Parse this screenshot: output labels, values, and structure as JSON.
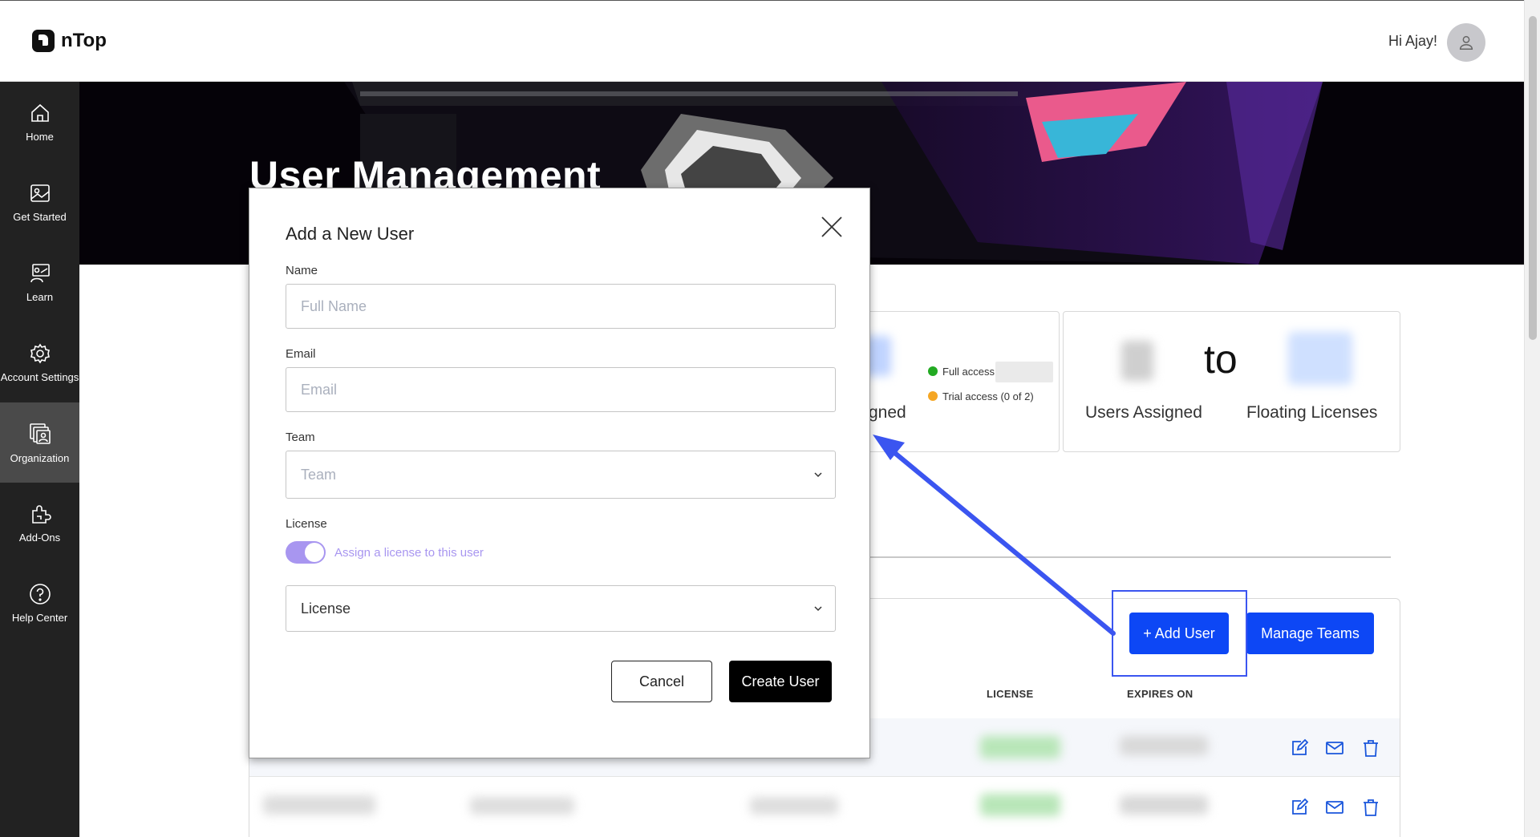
{
  "app": {
    "brand": "nTop",
    "greeting": "Hi Ajay!"
  },
  "icons": {
    "logo": "ntop-logo-icon",
    "avatar": "user-avatar-icon",
    "close": "close-icon",
    "chevron": "chevron-down-icon",
    "edit": "edit-icon",
    "email": "mail-icon",
    "delete": "trash-icon"
  },
  "sidebar": {
    "items": [
      {
        "label": "Home",
        "icon": "home-icon"
      },
      {
        "label": "Get Started",
        "icon": "image-icon"
      },
      {
        "label": "Learn",
        "icon": "learn-icon"
      },
      {
        "label": "Account Settings",
        "icon": "gear-icon"
      },
      {
        "label": "Organization",
        "icon": "organization-icon",
        "active": true
      },
      {
        "label": "Add-Ons",
        "icon": "puzzle-icon"
      },
      {
        "label": "Help Center",
        "icon": "help-icon"
      }
    ]
  },
  "hero": {
    "title": "User Management"
  },
  "license_card": {
    "partial_label": "gned",
    "legend": [
      {
        "label": "Full access",
        "color": "#22aa22"
      },
      {
        "label": "Trial access (0 of 2)",
        "color": "#f5a623"
      }
    ]
  },
  "floating_card": {
    "connector": "to",
    "left_label": "Users Assigned",
    "right_label": "Floating Licenses"
  },
  "user_table": {
    "add_user_label": "+ Add User",
    "manage_teams_label": "Manage Teams",
    "columns": [
      "LICENSE",
      "EXPIRES ON"
    ]
  },
  "modal": {
    "title": "Add a New User",
    "name": {
      "label": "Name",
      "placeholder": "Full Name",
      "value": ""
    },
    "email": {
      "label": "Email",
      "placeholder": "Email",
      "value": ""
    },
    "team": {
      "label": "Team",
      "placeholder": "Team"
    },
    "license": {
      "label": "License",
      "toggle_on": true,
      "toggle_text": "Assign a license to this user",
      "select_value": "License"
    },
    "cancel_label": "Cancel",
    "create_label": "Create User"
  },
  "colors": {
    "sidebar_bg": "#222222",
    "sidebar_active": "#4a4a4a",
    "primary_blue": "#0d47f5",
    "toggle_purple": "#a896f0",
    "annotation_blue": "#3b55f0"
  }
}
